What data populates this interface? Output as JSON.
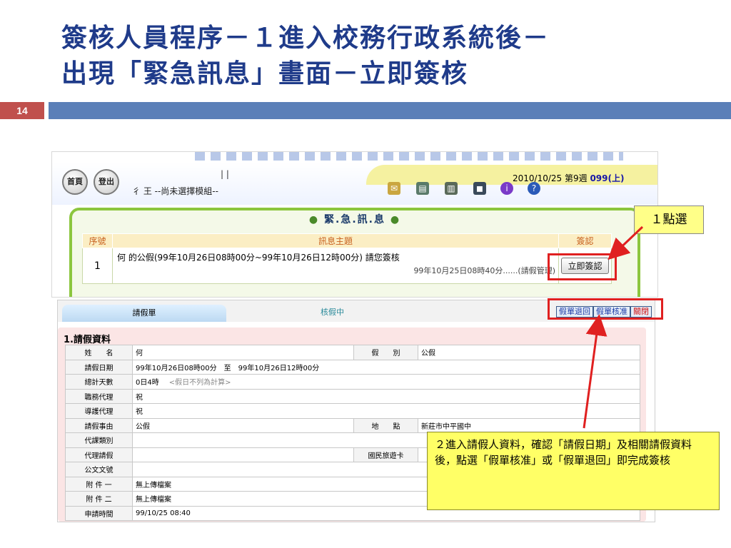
{
  "slide": {
    "title_line1": "簽核人員程序－１進入校務行政系統後－",
    "title_line2": "出現「緊急訊息」畫面－立即簽核",
    "page_number": "14"
  },
  "screen1": {
    "home_button": "首頁",
    "logout_button": "登出",
    "system_name": "|           |",
    "date_prefix": "2010/10/25 第9週 ",
    "date_week": "099(上)",
    "module_text": "彳                  王 --尚未選擇模組--",
    "urgent_title": "緊.急.訊.息",
    "table": {
      "headers": [
        "序號",
        "訊息主題",
        "簽認"
      ],
      "row": {
        "index": "1",
        "subject": "何        的公假(99年10月26日08時00分~99年10月26日12時00分) 請您簽核",
        "meta": "99年10月25日08時40分......(請假管理)",
        "confirm_button": "立即簽認"
      }
    }
  },
  "screen2": {
    "tab_label": "請假單",
    "status": "核假中",
    "buttons": {
      "return": "假單退回",
      "approve": "假單核准",
      "close": "關閉"
    },
    "section_title": "1.請假資料",
    "rows": [
      {
        "label": "姓　　名",
        "value": "何",
        "label2": "假　　別",
        "value2": "公假"
      },
      {
        "label": "請假日期",
        "value": "99年10月26日08時00分　至　99年10月26日12時00分"
      },
      {
        "label": "總計天數",
        "value": "0日4時",
        "hint": "<假日不列為計算>"
      },
      {
        "label": "職務代理",
        "value": "祝"
      },
      {
        "label": "導護代理",
        "value": "祝"
      },
      {
        "label": "請假事由",
        "value": "公假",
        "label2": "地　　點",
        "value2": "新莊市中平國中"
      },
      {
        "label": "代課類別",
        "value": ""
      },
      {
        "label": "代理請假",
        "value": "",
        "label2": "國民旅遊卡",
        "value2": ""
      },
      {
        "label": "公文文號",
        "value": ""
      },
      {
        "label": "附 件 一",
        "value": "無上傳檔案"
      },
      {
        "label": "附 件 二",
        "value": "無上傳檔案"
      },
      {
        "label": "申請時間",
        "value": "99/10/25 08:40"
      }
    ]
  },
  "callouts": {
    "step1": "１點選",
    "step2": "２進入請假人資料，確認「請假日期」及相關請假資料後，點選「假單核准」或「假單退回」即完成簽核"
  },
  "colors": {
    "title": "#1f3b8a",
    "accent_bar": "#5b7fb8",
    "page_badge": "#c0504d",
    "highlight_red": "#e02020",
    "callout_yellow": "#ffff66"
  }
}
